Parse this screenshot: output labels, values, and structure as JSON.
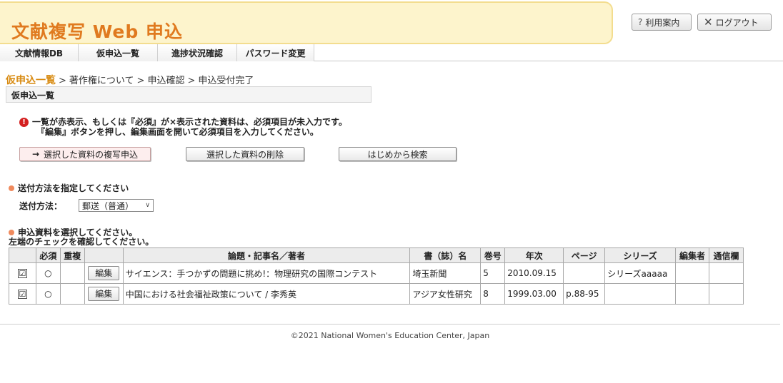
{
  "header": {
    "app_title": "文献複写 Web 申込",
    "help_label": "利用案内",
    "help_icon": "question-icon",
    "logout_label": "ログアウト",
    "logout_icon": "close-icon"
  },
  "nav": {
    "items": [
      {
        "label": "文献情報DB"
      },
      {
        "label": "仮申込一覧"
      },
      {
        "label": "進捗状況確認"
      },
      {
        "label": "パスワード変更"
      }
    ]
  },
  "breadcrumb": {
    "steps": [
      "仮申込一覧",
      "著作権について",
      "申込確認",
      "申込受付完了"
    ],
    "separator": ">"
  },
  "section": {
    "title": "仮申込一覧"
  },
  "warning": {
    "icon": "exclamation-icon",
    "line1": "一覧が赤表示、もしくは『必須』が×表示された資料は、必須項目が未入力です。",
    "line2": "『編集』ボタンを押し、編集画面を開いて必須項目を入力してください。"
  },
  "actions": {
    "request_label": "選択した資料の複写申込",
    "delete_label": "選択した資料の削除",
    "restart_label": "はじめから検索"
  },
  "shipping": {
    "heading": "送付方法を指定してください",
    "label": "送付方法：",
    "selected": "郵送（普通）"
  },
  "selection": {
    "heading_line1": "申込資料を選択してください。",
    "heading_line2": "左端のチェックを確認してください。"
  },
  "table": {
    "headers": [
      "",
      "必須",
      "重複",
      "",
      "論題・記事名／著者",
      "書（誌）名",
      "巻号",
      "年次",
      "ページ",
      "シリーズ",
      "編集者",
      "通信欄"
    ],
    "rows": [
      {
        "checked": "☑",
        "required": "○",
        "duplicate": "",
        "edit_label": "編集",
        "title": "サイエンス：手つかずの問題に挑め!：物理研究の国際コンテスト",
        "journal": "埼玉新聞",
        "volume": "5",
        "year": "2010.09.15",
        "page": "",
        "series": "シリーズaaaaa",
        "editor": "",
        "memo": ""
      },
      {
        "checked": "☑",
        "required": "○",
        "duplicate": "",
        "edit_label": "編集",
        "title": "中国における社会福祉政策について / 李秀英",
        "journal": "アジア女性研究",
        "volume": "8",
        "year": "1999.03.00",
        "page": "p.88-95",
        "series": "",
        "editor": "",
        "memo": ""
      }
    ]
  },
  "footer": {
    "copyright": "©2021 National Women's Education Center, Japan"
  },
  "colors": {
    "banner_bg": "#fdf4cc",
    "title_orange": "#e07a1f",
    "breadcrumb_current": "#d88b12",
    "warning_red": "#d42020",
    "bullet_orange": "#f08a5d"
  }
}
